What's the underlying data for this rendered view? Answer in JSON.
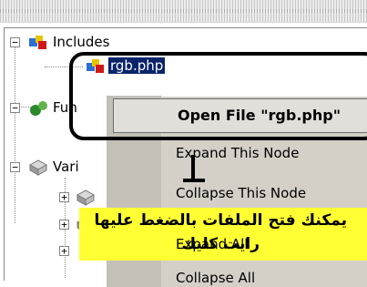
{
  "tree": {
    "nodes": [
      {
        "label": "Includes",
        "expander": "−"
      },
      {
        "label": "rgb.php",
        "selected": true
      },
      {
        "label": "Fun",
        "expander": "−"
      },
      {
        "label": "Vari",
        "expander": "−"
      },
      {
        "label": "",
        "expander": "+"
      },
      {
        "label": "",
        "expander": "+"
      },
      {
        "label": "",
        "expander": "+"
      }
    ]
  },
  "context_menu": {
    "default_item": "Open File \"rgb.php\"",
    "items": [
      "Expand This Node",
      "Collapse This Node",
      "Expand All",
      "Collapse All"
    ]
  },
  "annotation": {
    "line1": "يمكنك فتح الملفات بالضغط عليها",
    "line2": "رايت كليك"
  },
  "colors": {
    "selection": "#0a246a",
    "menu_bg": "#d4d0c8",
    "note_bg": "#ffff33",
    "callout": "#000000"
  }
}
